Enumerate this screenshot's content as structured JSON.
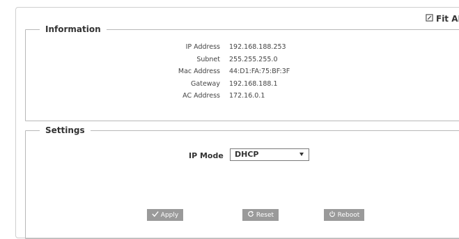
{
  "toolbar": {
    "fit_ap_label": "Fit AP"
  },
  "information": {
    "legend": "Information",
    "rows": [
      {
        "label": "IP Address",
        "value": "192.168.188.253"
      },
      {
        "label": "Subnet",
        "value": "255.255.255.0"
      },
      {
        "label": "Mac Address",
        "value": "44:D1:FA:75:BF:3F"
      },
      {
        "label": "Gateway",
        "value": "192.168.188.1"
      },
      {
        "label": "AC Address",
        "value": "172.16.0.1"
      }
    ]
  },
  "settings": {
    "legend": "Settings",
    "ip_mode_label": "IP Mode",
    "ip_mode_selected": "DHCP",
    "apply_label": "Apply",
    "reset_label": "Reset",
    "reboot_label": "Reboot"
  },
  "icons": {
    "fit_ap": "edit-icon",
    "apply": "checkmark-icon",
    "reset": "refresh-icon",
    "reboot": "power-icon"
  },
  "colors": {
    "button_bg": "#9a9a9a",
    "border": "#b8b8b8"
  }
}
